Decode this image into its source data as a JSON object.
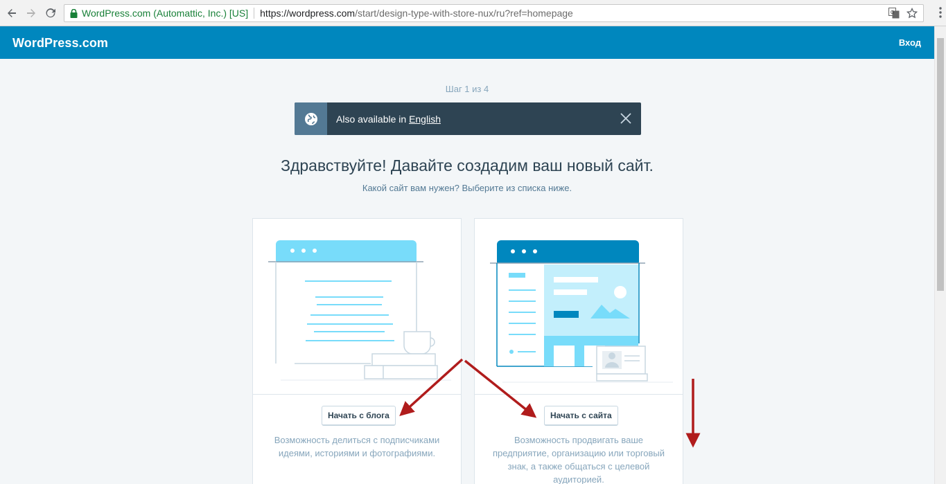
{
  "browser": {
    "secure_label": "WordPress.com (Automattic, Inc.) [US]",
    "url_host": "https://wordpress.com",
    "url_path": "/start/design-type-with-store-nux/ru?ref=homepage",
    "icons": [
      "back-icon",
      "forward-icon",
      "reload-icon",
      "lock-icon",
      "translate-icon",
      "star-icon",
      "menu-icon"
    ]
  },
  "masterbar": {
    "brand": "WordPress.com",
    "login": "Вход",
    "color": "#0087be"
  },
  "signup": {
    "step": "Шаг 1 из 4",
    "notice": {
      "text": "Also available in",
      "link": "English"
    },
    "headline": "Здравствуйте! Давайте создадим ваш новый сайт.",
    "subheadline": "Какой сайт вам нужен? Выберите из списка ниже.",
    "cards": [
      {
        "button": "Начать с блога",
        "description": "Возможность делиться с подписчиками идеями, историями и фотографиями."
      },
      {
        "button": "Начать с сайта",
        "description": "Возможность продвигать ваше предприятие, организацию или торговый знак, а также общаться с целевой аудиторией."
      }
    ]
  },
  "annotation_color": "#b01c1c"
}
